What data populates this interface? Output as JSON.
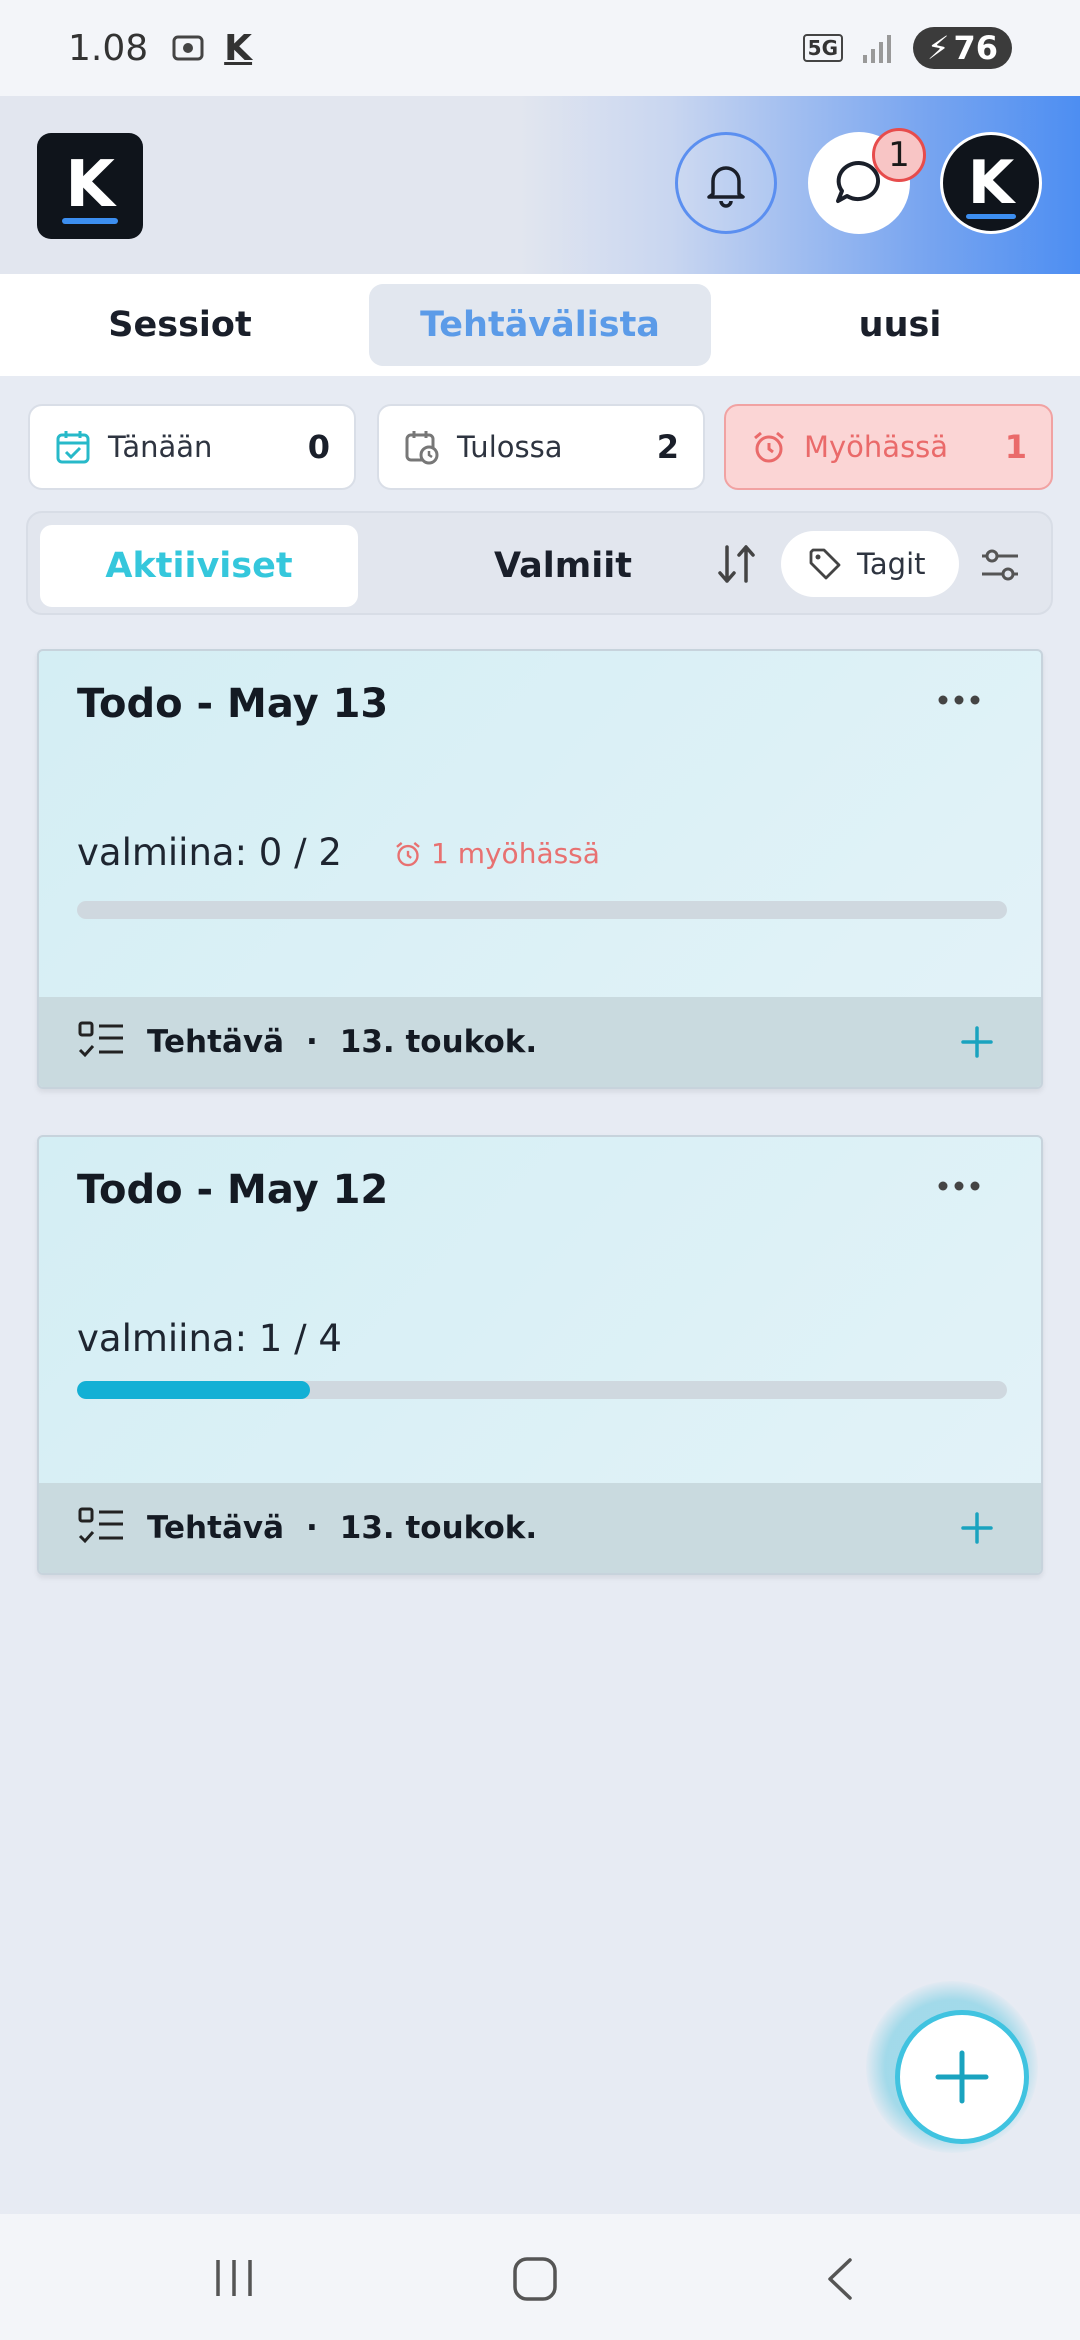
{
  "status_bar": {
    "time": "1.08",
    "network": "5G",
    "battery": "76",
    "app_badge": "K"
  },
  "app_bar": {
    "logo_letter": "K",
    "chat_badge_count": "1",
    "avatar_letter": "K",
    "gradient_colors": [
      "#e2e6ef",
      "#7aa6f0",
      "#4d8ef2"
    ]
  },
  "tabs": [
    {
      "label": "Sessiot",
      "active": false
    },
    {
      "label": "Tehtävälista",
      "active": true
    },
    {
      "label": "uusi",
      "active": false
    }
  ],
  "stats": [
    {
      "icon": "calendar-check-icon",
      "label": "Tänään",
      "count": "0"
    },
    {
      "icon": "calendar-clock-icon",
      "label": "Tulossa",
      "count": "2"
    },
    {
      "icon": "alarm-icon",
      "label": "Myöhässä",
      "count": "1"
    }
  ],
  "filters": {
    "active_label": "Aktiiviset",
    "done_label": "Valmiit",
    "tags_label": "Tagit"
  },
  "cards": [
    {
      "title": "Todo - May 13",
      "progress_text": "valmiina: 0 / 2",
      "late_note": "1 myöhässä",
      "progress": 0.0,
      "footer_type": "Tehtävä",
      "footer_sep": "·",
      "footer_date": "13. toukok."
    },
    {
      "title": "Todo - May 12",
      "progress_text": "valmiina: 1 / 4",
      "late_note": "",
      "progress": 0.25,
      "footer_type": "Tehtävä",
      "footer_sep": "·",
      "footer_date": "13. toukok."
    }
  ],
  "colors": {
    "accent": "#35c7dc",
    "tab_active": "#5b9be8",
    "late": "#ea6a6a",
    "progress_fill": "#13b0d5"
  }
}
